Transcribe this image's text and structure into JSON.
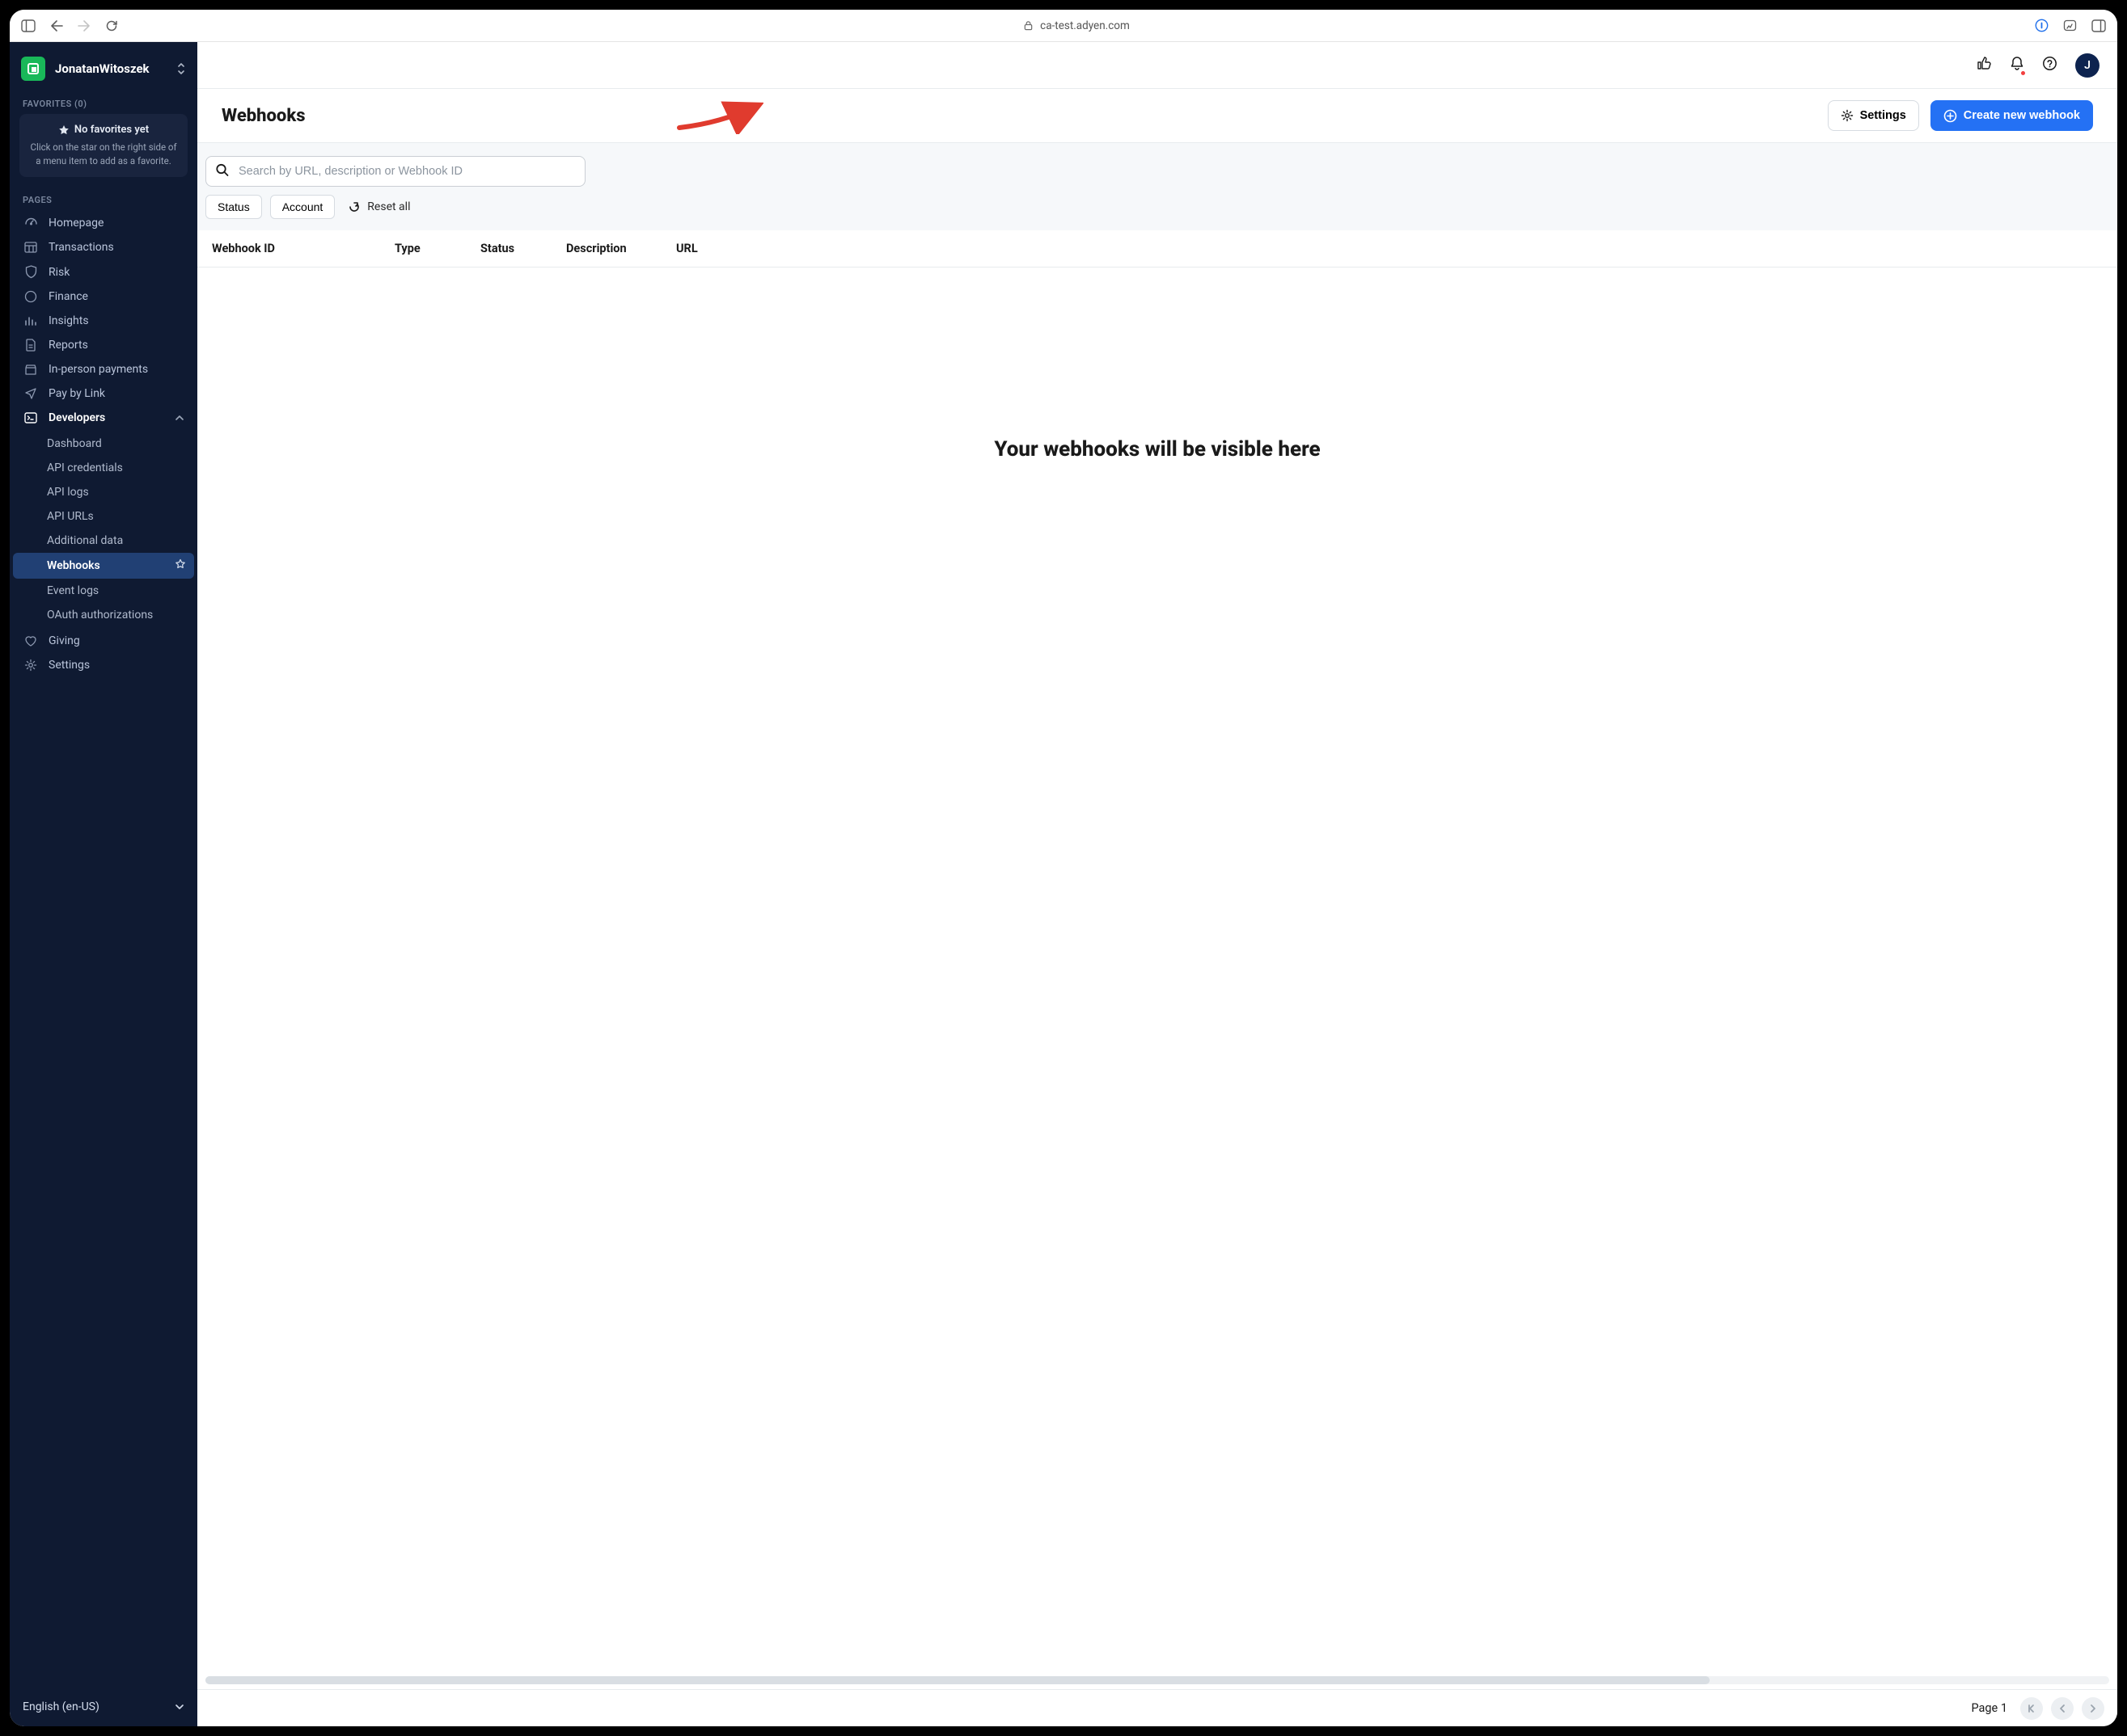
{
  "browser": {
    "url": "ca-test.adyen.com"
  },
  "account": {
    "name": "JonatanWitoszek",
    "avatar_initial": "J"
  },
  "sidebar": {
    "favorites_label": "FAVORITES (0)",
    "favorites_empty_title": "No favorites yet",
    "favorites_empty_desc": "Click on the star on the right side of a menu item to add as a favorite.",
    "pages_label": "PAGES",
    "items": [
      {
        "label": "Homepage"
      },
      {
        "label": "Transactions"
      },
      {
        "label": "Risk"
      },
      {
        "label": "Finance"
      },
      {
        "label": "Insights"
      },
      {
        "label": "Reports"
      },
      {
        "label": "In-person payments"
      },
      {
        "label": "Pay by Link"
      },
      {
        "label": "Developers"
      },
      {
        "label": "Giving"
      },
      {
        "label": "Settings"
      }
    ],
    "developers_sub": [
      {
        "label": "Dashboard"
      },
      {
        "label": "API credentials"
      },
      {
        "label": "API logs"
      },
      {
        "label": "API URLs"
      },
      {
        "label": "Additional data"
      },
      {
        "label": "Webhooks"
      },
      {
        "label": "Event logs"
      },
      {
        "label": "OAuth authorizations"
      }
    ],
    "language": "English (en-US)"
  },
  "page": {
    "title": "Webhooks",
    "settings_label": "Settings",
    "create_label": "Create new webhook",
    "search_placeholder": "Search by URL, description or Webhook ID",
    "filters": {
      "status": "Status",
      "account": "Account",
      "reset": "Reset all"
    },
    "columns": {
      "id": "Webhook ID",
      "type": "Type",
      "status": "Status",
      "desc": "Description",
      "url": "URL"
    },
    "empty_message": "Your webhooks will be visible here",
    "page_label": "Page 1"
  }
}
